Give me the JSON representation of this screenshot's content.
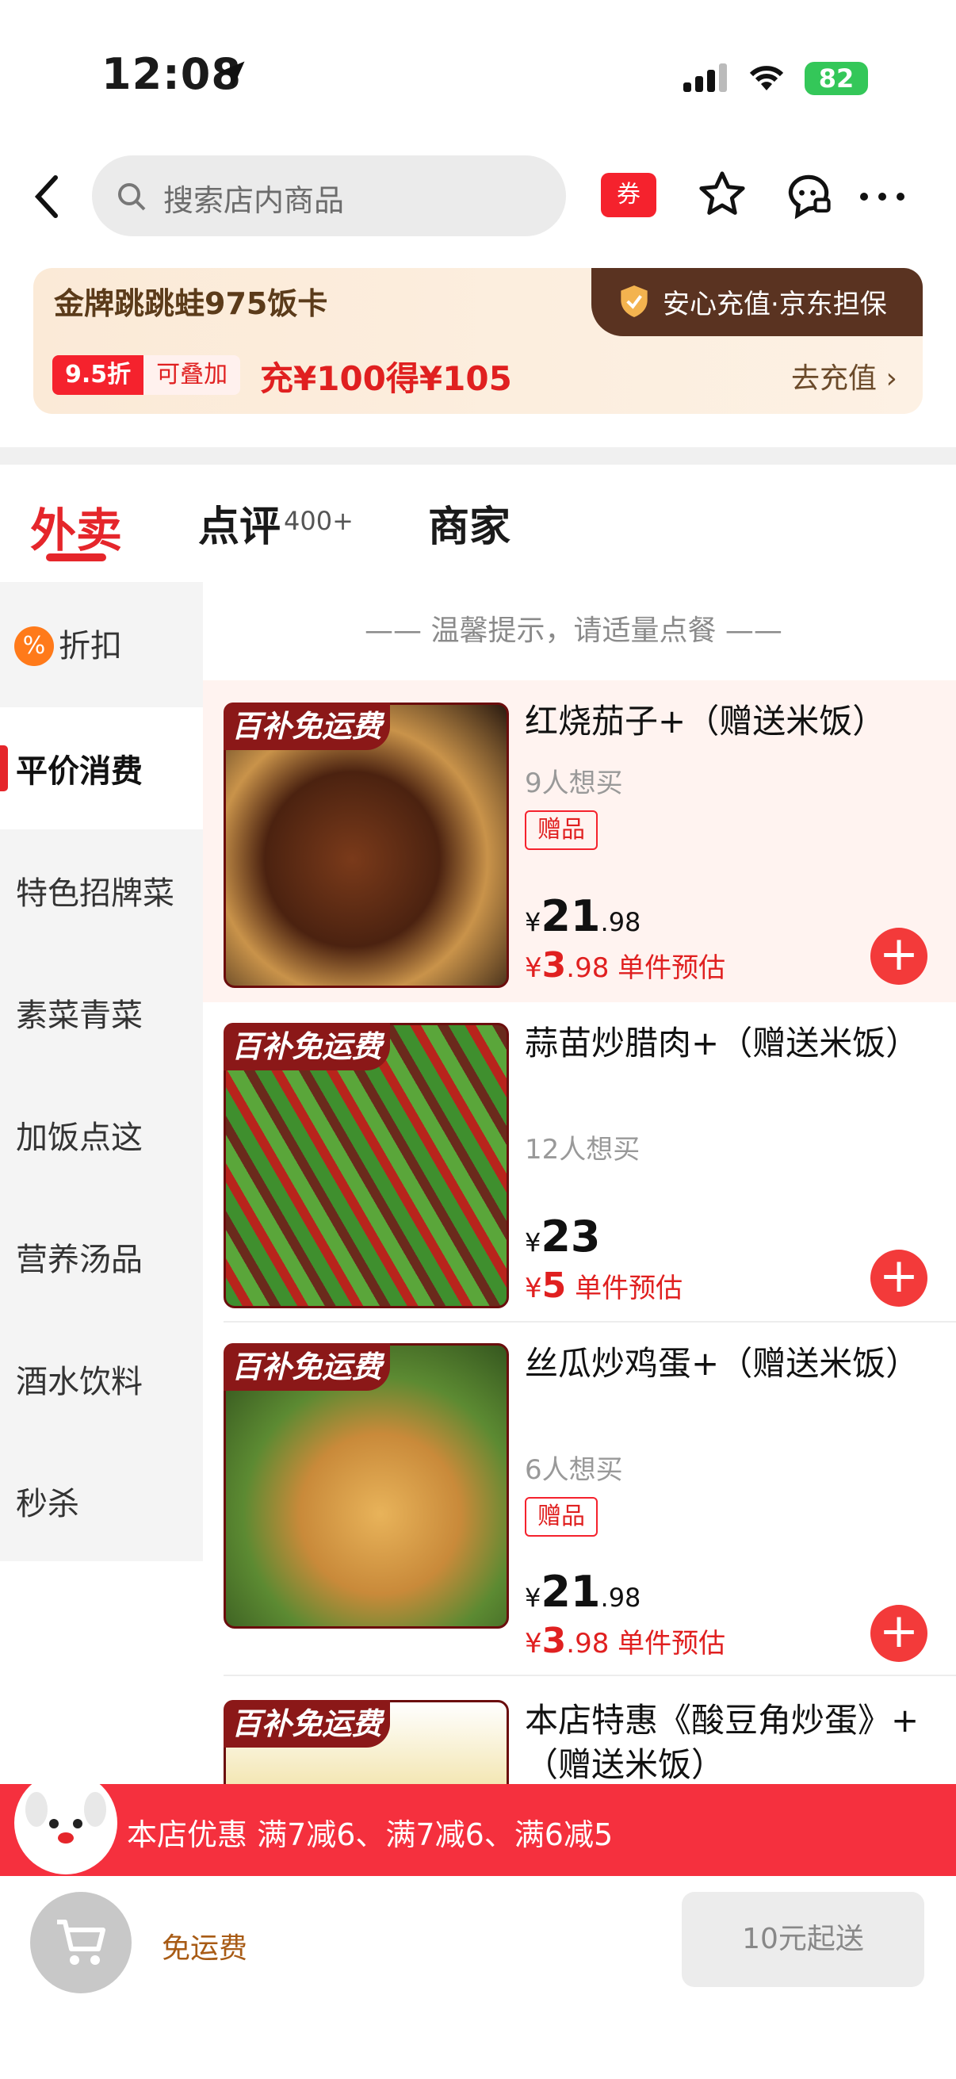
{
  "status_bar": {
    "time": "12:08",
    "battery": "82"
  },
  "header": {
    "search_placeholder": "搜索店内商品",
    "coupon_label": "券"
  },
  "card": {
    "title": "金牌跳跳蛙975饭卡",
    "guarantee": "安心充值·京东担保",
    "discount": "9.5折",
    "stackable": "可叠加",
    "offer": "充¥100得¥105",
    "cta": "去充值"
  },
  "tabs": [
    {
      "label": "外卖"
    },
    {
      "label": "点评",
      "count": "400+"
    },
    {
      "label": "商家"
    }
  ],
  "sidebar": [
    {
      "label": "折扣"
    },
    {
      "label": "平价消费"
    },
    {
      "label": "特色招牌菜"
    },
    {
      "label": "素菜青菜"
    },
    {
      "label": "加饭点这"
    },
    {
      "label": "营养汤品"
    },
    {
      "label": "酒水饮料"
    },
    {
      "label": "秒杀"
    }
  ],
  "tip": "—— 温馨提示，请适量点餐 ——",
  "badge_label": "百补免运费",
  "items": [
    {
      "name": "红烧茄子+（赠送米饭）",
      "want": "9人想买",
      "gift": "赠品",
      "price": "21",
      "price_decimal": ".98",
      "est_price": "3",
      "est_decimal": ".98",
      "est_label": "单件预估"
    },
    {
      "name": "蒜苗炒腊肉+（赠送米饭）",
      "want": "12人想买",
      "price": "23",
      "est_price": "5",
      "est_label": "单件预估"
    },
    {
      "name": "丝瓜炒鸡蛋+（赠送米饭）",
      "want": "6人想买",
      "gift": "赠品",
      "price": "21",
      "price_decimal": ".98",
      "est_price": "3",
      "est_decimal": ".98",
      "est_label": "单件预估"
    },
    {
      "name": "本店特惠《酸豆角炒蛋》+（赠送米饭）"
    }
  ],
  "promo": {
    "text": "本店优惠  满7减6、满7减6、满6减5"
  },
  "footer": {
    "shipping": "免运费",
    "min_order": "10元起送"
  },
  "colors": {
    "accent": "#e5262b",
    "promo": "#f5303e",
    "card": "#fbead7"
  }
}
